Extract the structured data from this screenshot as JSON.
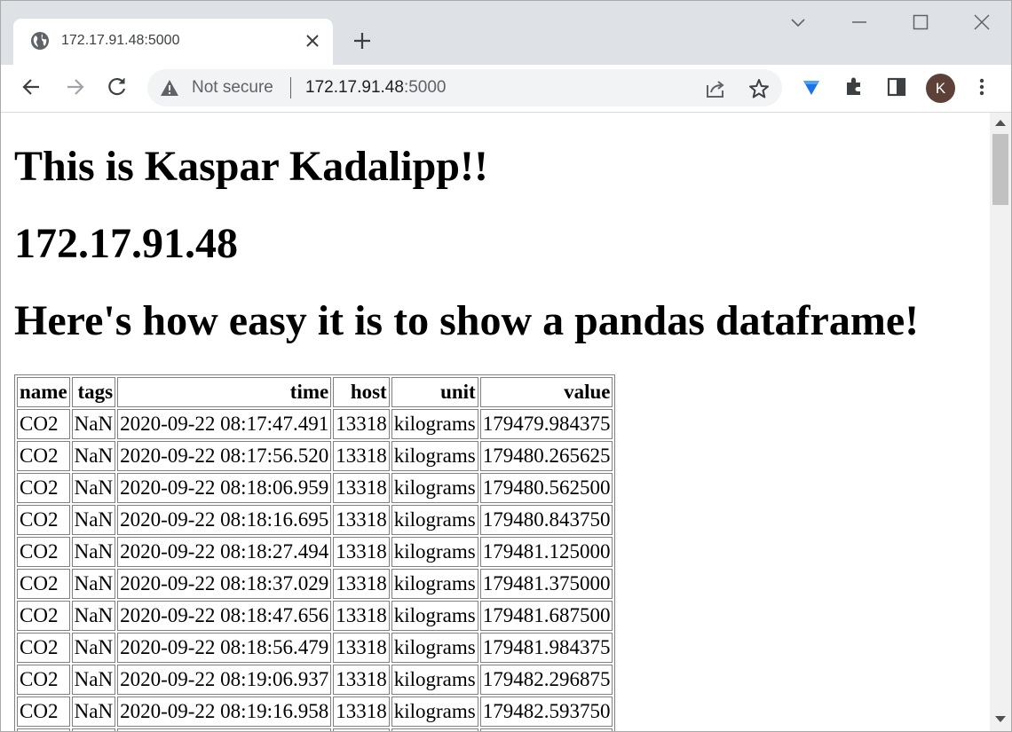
{
  "tab": {
    "title": "172.17.91.48:5000"
  },
  "omnibox": {
    "security_label": "Not secure",
    "url_host": "172.17.91.48",
    "url_port": ":5000"
  },
  "profile": {
    "initial": "K",
    "color": "#5d4037"
  },
  "page": {
    "heading1": "This is Kaspar Kadalipp!!",
    "heading2": "172.17.91.48",
    "heading3": "Here's how easy it is to show a pandas dataframe!"
  },
  "table": {
    "columns": [
      "name",
      "tags",
      "time",
      "host",
      "unit",
      "value"
    ],
    "rows": [
      [
        "CO2",
        "NaN",
        "2020-09-22 08:17:47.491",
        "13318",
        "kilograms",
        "179479.984375"
      ],
      [
        "CO2",
        "NaN",
        "2020-09-22 08:17:56.520",
        "13318",
        "kilograms",
        "179480.265625"
      ],
      [
        "CO2",
        "NaN",
        "2020-09-22 08:18:06.959",
        "13318",
        "kilograms",
        "179480.562500"
      ],
      [
        "CO2",
        "NaN",
        "2020-09-22 08:18:16.695",
        "13318",
        "kilograms",
        "179480.843750"
      ],
      [
        "CO2",
        "NaN",
        "2020-09-22 08:18:27.494",
        "13318",
        "kilograms",
        "179481.125000"
      ],
      [
        "CO2",
        "NaN",
        "2020-09-22 08:18:37.029",
        "13318",
        "kilograms",
        "179481.375000"
      ],
      [
        "CO2",
        "NaN",
        "2020-09-22 08:18:47.656",
        "13318",
        "kilograms",
        "179481.687500"
      ],
      [
        "CO2",
        "NaN",
        "2020-09-22 08:18:56.479",
        "13318",
        "kilograms",
        "179481.984375"
      ],
      [
        "CO2",
        "NaN",
        "2020-09-22 08:19:06.937",
        "13318",
        "kilograms",
        "179482.296875"
      ],
      [
        "CO2",
        "NaN",
        "2020-09-22 08:19:16.958",
        "13318",
        "kilograms",
        "179482.593750"
      ],
      [
        "",
        "",
        "",
        "",
        "",
        ""
      ]
    ]
  }
}
